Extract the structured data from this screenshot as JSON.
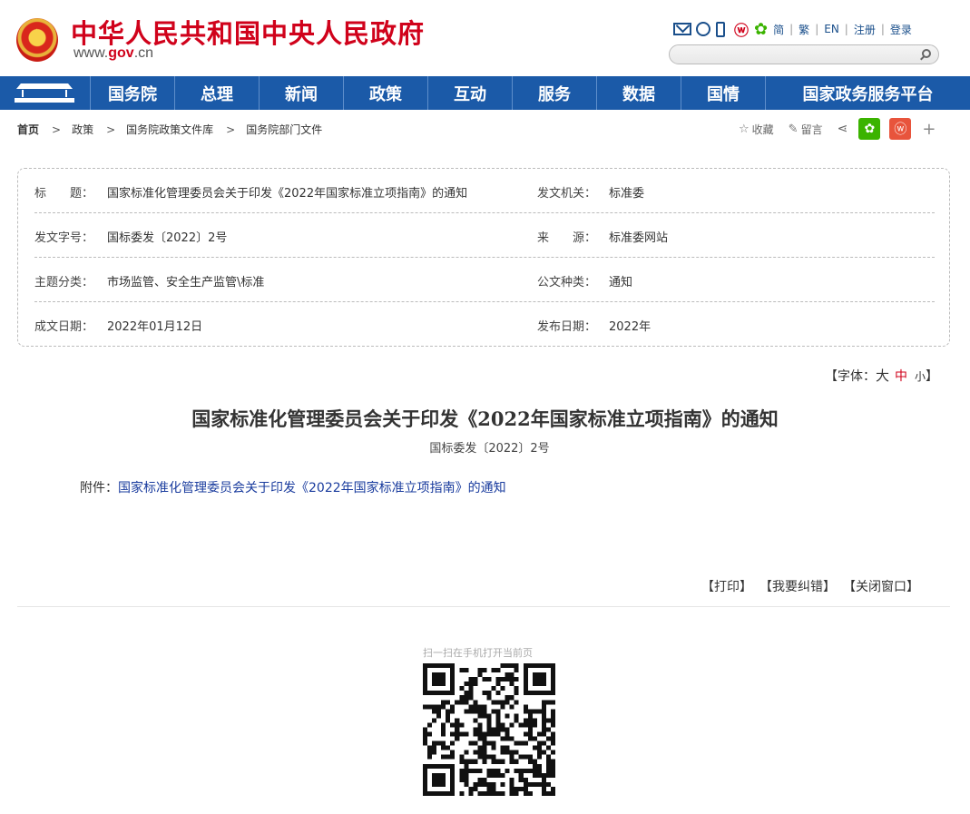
{
  "header": {
    "site_title": "中华人民共和国中央人民政府",
    "domain_prefix": "www.",
    "domain_gov": "gov",
    "domain_suffix": ".cn",
    "lang_links": [
      "简",
      "繁",
      "EN",
      "注册",
      "登录"
    ],
    "search_placeholder": ""
  },
  "nav": {
    "items": [
      "国务院",
      "总理",
      "新闻",
      "政策",
      "互动",
      "服务",
      "数据",
      "国情",
      "国家政务服务平台"
    ]
  },
  "breadcrumb": [
    "首页",
    "政策",
    "国务院政策文件库",
    "国务院部门文件"
  ],
  "tools": {
    "favorite": "收藏",
    "comment": "留言"
  },
  "meta": {
    "title_label": "标　　题：",
    "title_value": "国家标准化管理委员会关于印发《2022年国家标准立项指南》的通知",
    "issuer_label": "发文机关：",
    "issuer_value": "标准委",
    "docno_label": "发文字号：",
    "docno_value": "国标委发〔2022〕2号",
    "source_label": "来　　源：",
    "source_value": "标准委网站",
    "topic_label": "主题分类：",
    "topic_value": "市场监管、安全生产监管\\标准",
    "type_label": "公文种类：",
    "type_value": "通知",
    "date_label": "成文日期：",
    "date_value": "2022年01月12日",
    "pubdate_label": "发布日期：",
    "pubdate_value": "2022年"
  },
  "font_size": {
    "prefix": "【字体：",
    "big": "大",
    "mid": "中",
    "small": "小",
    "suffix": "】"
  },
  "article": {
    "title": "国家标准化管理委员会关于印发《2022年国家标准立项指南》的通知",
    "doc_number": "国标委发〔2022〕2号",
    "attachment_label": "附件：",
    "attachment_link": "国家标准化管理委员会关于印发《2022年国家标准立项指南》的通知"
  },
  "actions": {
    "print": "【打印】",
    "report_error": "【我要纠错】",
    "close_window": "【关闭窗口】"
  },
  "qr": {
    "caption": "扫一扫在手机打开当前页"
  },
  "colors": {
    "brand_red": "#d0021b",
    "nav_blue": "#1b5aa8",
    "link_blue": "#1a3c9e"
  }
}
